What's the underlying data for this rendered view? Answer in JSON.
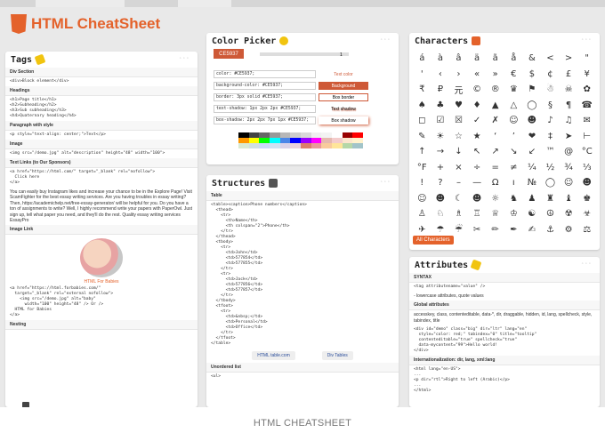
{
  "app": {
    "title": "HTML CheatSheet"
  },
  "caption": "HTML CHEATSHEET",
  "tags": {
    "title": "Tags",
    "sections": [
      {
        "label": "Div Section",
        "lines": [
          "<div>Block element</div>"
        ]
      },
      {
        "label": "Headings",
        "lines": [
          "<h1>Page title</h1>",
          "<h2>Subheading</h2>",
          "<h3>Sub subheading</h3>",
          "<h4>Quaternary heading</h4>"
        ]
      },
      {
        "label": "Paragraph with style",
        "lines": [
          "<p style=\"text-align: center;\">Text</p>"
        ]
      },
      {
        "label": "Image",
        "lines": [
          "<img src=\"/demo.jpg\" alt=\"description\" height=\"48\" width=\"100\">"
        ]
      },
      {
        "label": "Text Links (to Our Sponsors)",
        "lines": [
          "<a href=\"https://html.com/\" target=\"_blank\" rel=\"nofollow\">",
          "  Click here",
          "</a>"
        ]
      }
    ],
    "sponsor_text": "You can easily buy Instagram likes and increase your chance to be in the Explore Page! Visit ScamFighter for the best essay writing services. Are you having troubles in essay writing? Then, https://academichelp.net/free-essay-generator/ will be helpful for you. Do you have a ton of assignments to write? Well, I highly recommend write your papers with PaperOwl. Just sign up, tell what paper you need, and they'll do the rest. Quality essay writing services EssayPro",
    "image_link_label": "Image Link",
    "image_link_caption": "HTML For Babies",
    "image_link_code": [
      "<a href=\"https://html.forbabies.com/\"",
      "  target=\"_blank\" rel=\"external nofollow\">",
      "    <img src=\"/demo.jpg\" alt=\"baby\"",
      "      width=\"100\" height=\"48\" /> Or />",
      "  HTML for Babies",
      "</a>"
    ],
    "trailing_label": "Nesting"
  },
  "picker": {
    "title": "Color Picker",
    "hex": "CE5937",
    "number": "1",
    "rows": [
      {
        "field": "color: #CE5937;",
        "demo": "Text color"
      },
      {
        "field": "background-color: #CE5937;",
        "demo": "Background"
      },
      {
        "field": "border: 3px solid #CE5937;",
        "demo": "Box border"
      },
      {
        "field": "text-shadow: 1px 2px 2px #CE5937;",
        "demo": "Text shadow"
      },
      {
        "field": "box-shadow: 2px 2px 7px 1px #CE5937;",
        "demo": "Box shadow"
      }
    ],
    "swatches": [
      "#000000",
      "#434343",
      "#666666",
      "#999999",
      "#b7b7b7",
      "#cccccc",
      "#d9d9d9",
      "#efefef",
      "#f3f3f3",
      "#ffffff",
      "#980000",
      "#ff0000",
      "#ff9900",
      "#ffff00",
      "#00ff00",
      "#00ffff",
      "#4a86e8",
      "#0000ff",
      "#9900ff",
      "#ff00ff",
      "#e6b8af",
      "#f4cccc",
      "#fce5cd",
      "#fff2cc",
      "#d9ead3",
      "#d0e0e3",
      "#c9daf8",
      "#cfe2f3",
      "#d9d2e9",
      "#ead1dc",
      "#dd7e6b",
      "#ea9999",
      "#f9cb9c",
      "#ffe599",
      "#b6d7a8",
      "#a2c4c9"
    ]
  },
  "structures": {
    "title": "Structures",
    "table_label": "Table",
    "table_code": [
      "<table><caption>Phone numbers</caption>",
      "  <thead>",
      "    <tr>",
      "      <th>Name</th>",
      "      <th colspan=\"2\">Phone</th>",
      "    </tr>",
      "  </thead>",
      "  <tbody>",
      "    <tr>",
      "      <td>John</td>",
      "      <td>577854</td>",
      "      <td>577855</td>",
      "    </tr>",
      "    <tr>",
      "      <td>Jack</td>",
      "      <td>577856</td>",
      "      <td>577857</td>",
      "    </tr>",
      "  </tbody>",
      "  <tfoot>",
      "    <tr>",
      "      <td>&nbsp;</td>",
      "      <td>Personal</td>",
      "      <td>Office</td>",
      "    </tr>",
      "  </tfoot>",
      "</table>"
    ],
    "btn_table": "HTML table.com",
    "btn_div": "Div Tables",
    "list_label": "Unordered list",
    "list_code": [
      "<ul>"
    ]
  },
  "characters": {
    "title": "Characters",
    "glyphs": [
      "á",
      "à",
      "â",
      "ä",
      "ã",
      "å",
      "&",
      "<",
      ">",
      "\"",
      "'",
      "‹",
      "›",
      "«",
      "»",
      "€",
      "$",
      "¢",
      "£",
      "¥",
      "₹",
      "₽",
      "元",
      "©",
      "®",
      "♛",
      "⚑",
      "☃",
      "☠",
      "✿",
      "♠",
      "♣",
      "♥",
      "♦",
      "▲",
      "△",
      "◯",
      "§",
      "¶",
      "☎",
      "◻",
      "☑",
      "☒",
      "✓",
      "✗",
      "☺",
      "☻",
      "♪",
      "♫",
      "✉",
      "✎",
      "☀",
      "☆",
      "★",
      "‘",
      "’",
      "❤",
      "‡",
      "➤",
      "⊢",
      "↑",
      "→",
      "↓",
      "↖",
      "↗",
      "↘",
      "↙",
      "™",
      "@",
      "°C",
      "°F",
      "+",
      "×",
      "÷",
      "=",
      "≠",
      "¼",
      "½",
      "¾",
      "⅓",
      "!",
      "?",
      "–",
      "—",
      "Ω",
      "ı",
      "№",
      "◯",
      "☺",
      "☻",
      "☺",
      "☻",
      "☾",
      "☻",
      "☼",
      "♞",
      "♟",
      "♜",
      "♝",
      "♚",
      "♙",
      "♘",
      "♗",
      "♖",
      "♕",
      "♔",
      "☯",
      "☮",
      "☢",
      "☣",
      "✈",
      "☂",
      "☔",
      "✂",
      "✏",
      "✒",
      "✍",
      "⚓",
      "⚙",
      "⚖"
    ],
    "all_label": "All Characters"
  },
  "attributes": {
    "title": "Attributes",
    "syntax_label": "SYNTAX",
    "syntax_code": [
      "<tag attributename=\"value\" />"
    ],
    "syntax_note": "- lowercase attributes, quote values",
    "global_label": "Global attributes",
    "global_note": "accesskey, class, contenteditable, data-*, dir, draggable, hidden, id, lang, spellcheck, style, tabindex, title",
    "global_code": [
      "<div id=\"demo\" class=\"big\" dir=\"ltr\" lang=\"en\"",
      "  style=\"color: red;\" tabindex=\"0\" title=\"tooltip\"",
      "  contenteditable=\"true\" spellcheck=\"true\"",
      "  data-mycontent=\"99\">Hello world!",
      "</div>"
    ],
    "i18n_label": "Internationalization: dir, lang, xml:lang",
    "i18n_code": [
      "<html lang=\"en-US\">",
      "...",
      "<p dir=\"rtl\">Right to left (Arabic)</p>",
      "...",
      "</html>"
    ]
  }
}
